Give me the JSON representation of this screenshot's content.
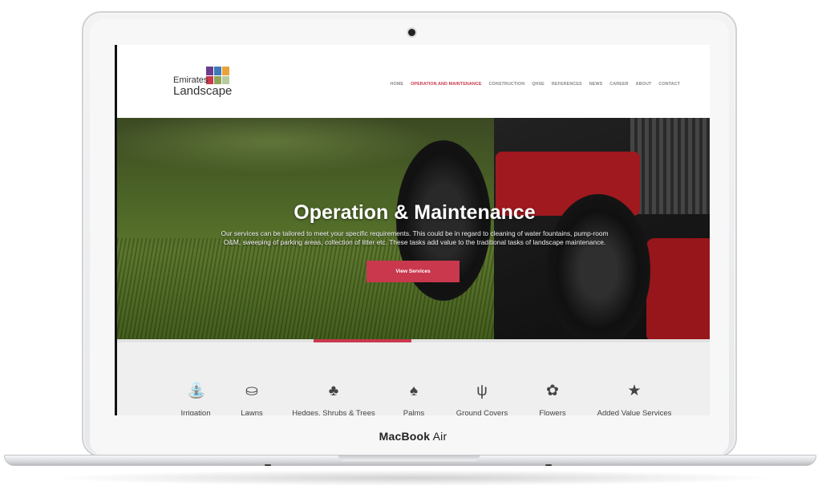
{
  "device": {
    "brand_bold": "MacBook",
    "brand_light": " Air"
  },
  "site": {
    "logo": {
      "line1": "Emirates",
      "line2": "Landscape"
    },
    "nav": [
      "HOME",
      "OPERATION AND MAINTENANCE",
      "CONSTRUCTION",
      "QHSE",
      "REFERENCES",
      "NEWS",
      "CAREER",
      "ABOUT",
      "CONTACT"
    ],
    "nav_active_index": 1,
    "hero": {
      "title": "Operation & Maintenance",
      "text": "Our services can be tailored to meet your specific requirements. This could be in regard to cleaning of water fountains, pump-room O&M, sweeping of parking areas, collection of litter etc. These tasks add value to the traditional tasks of landscape maintenance.",
      "button": "View Services"
    },
    "services": [
      {
        "label": "Irrigation",
        "icon": "watering-can-icon",
        "glyph": "⛲"
      },
      {
        "label": "Lawns",
        "icon": "lawn-mower-icon",
        "glyph": "⛀"
      },
      {
        "label": "Hedges, Shrubs & Trees",
        "icon": "tree-icon",
        "glyph": "♣"
      },
      {
        "label": "Palms",
        "icon": "palm-icon",
        "glyph": "♠"
      },
      {
        "label": "Ground Covers",
        "icon": "grass-icon",
        "glyph": "ψ"
      },
      {
        "label": "Flowers",
        "icon": "flowers-icon",
        "glyph": "✿"
      },
      {
        "label": "Added Value Services",
        "icon": "star-icon",
        "glyph": "★"
      }
    ]
  },
  "colors": {
    "accent": "#c9384d",
    "nav_text": "#8a8a8a"
  }
}
